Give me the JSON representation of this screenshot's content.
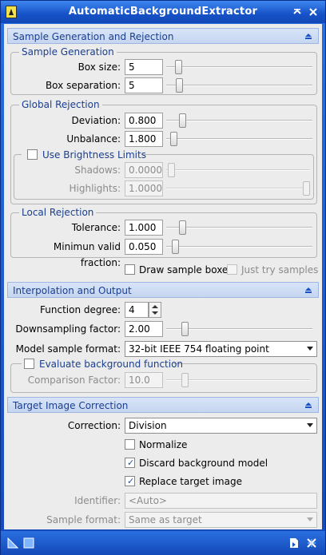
{
  "window": {
    "title": "AutomaticBackgroundExtractor"
  },
  "sections": {
    "sample_gen_rejection": "Sample Generation and Rejection",
    "interpolation": "Interpolation and Output",
    "target_correction": "Target Image Correction"
  },
  "sample_generation": {
    "title": "Sample Generation",
    "box_size": {
      "label": "Box size:",
      "value": "5",
      "slider_fraction": 0.05
    },
    "box_separation": {
      "label": "Box separation:",
      "value": "5",
      "slider_fraction": 0.06
    }
  },
  "global_rejection": {
    "title": "Global Rejection",
    "deviation": {
      "label": "Deviation:",
      "value": "0.800",
      "slider_fraction": 0.08
    },
    "unbalance": {
      "label": "Unbalance:",
      "value": "1.800",
      "slider_fraction": 0.02
    },
    "brightness": {
      "title": "Use Brightness Limits",
      "checked": false,
      "shadows": {
        "label": "Shadows:",
        "value": "0.0000",
        "slider_fraction": 0.0
      },
      "highlights": {
        "label": "Highlights:",
        "value": "1.0000",
        "slider_fraction": 1.0
      }
    }
  },
  "local_rejection": {
    "title": "Local Rejection",
    "tolerance": {
      "label": "Tolerance:",
      "value": "1.000",
      "slider_fraction": 0.08
    },
    "min_valid_fraction": {
      "label": "Minimun valid fraction:",
      "value": "0.050",
      "slider_fraction": 0.03
    }
  },
  "options": {
    "draw_sample_boxes": "Draw sample boxes",
    "just_try_samples": "Just try samples"
  },
  "interpolation": {
    "function_degree": {
      "label": "Function degree:",
      "value": "4"
    },
    "downsampling": {
      "label": "Downsampling factor:",
      "value": "2.00",
      "slider_fraction": 0.1
    },
    "model_format": {
      "label": "Model sample format:",
      "value": "32-bit IEEE 754 floating point"
    },
    "evaluate": {
      "title": "Evaluate background function",
      "checked": false,
      "comparison": {
        "label": "Comparison Factor:",
        "value": "10.0",
        "slider_fraction": 0.1
      }
    }
  },
  "correction": {
    "correction": {
      "label": "Correction:",
      "value": "Division"
    },
    "normalize": {
      "label": "Normalize",
      "checked": false
    },
    "discard_model": {
      "label": "Discard background model",
      "checked": true
    },
    "replace_target": {
      "label": "Replace target image",
      "checked": true
    },
    "identifier": {
      "label": "Identifier:",
      "placeholder": "<Auto>"
    },
    "sample_format": {
      "label": "Sample format:",
      "value": "Same as target"
    }
  },
  "colors": {
    "accent": "#1a3e8f",
    "header_bg": "#c6d6f1",
    "frame": "#1449b8",
    "check_mark": "#1f4fa8"
  }
}
